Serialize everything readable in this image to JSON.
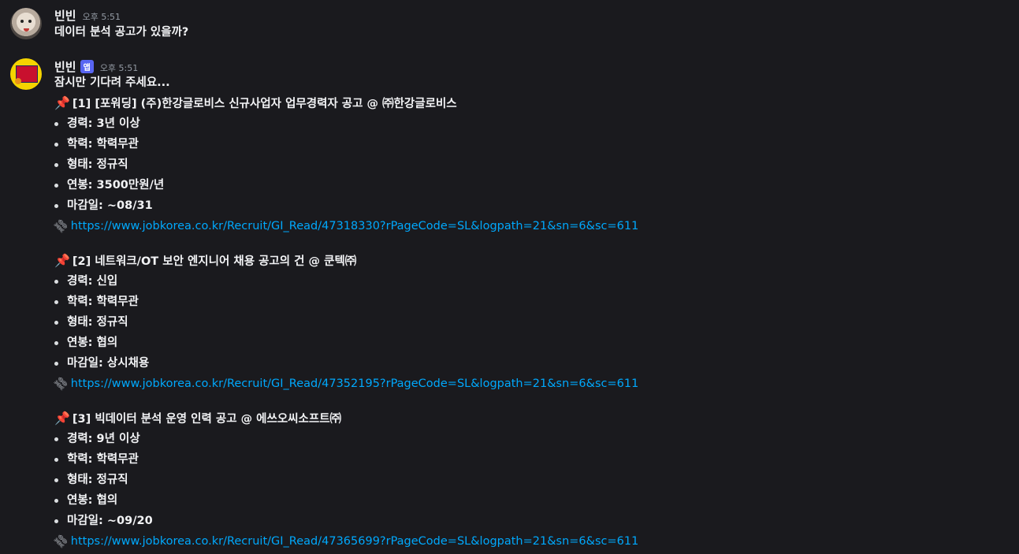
{
  "messages": [
    {
      "username": "빈빈",
      "time": "오후 5:51",
      "text": "데이터 분석 공고가 있을까?"
    },
    {
      "username": "빈빈",
      "app_tag": "앱",
      "time": "오후 5:51",
      "intro": "잠시만 기다려 주세요...",
      "jobs": [
        {
          "title": "[1] [포워딩] (주)한강글로비스 신규사업자 업무경력자 공고 @ ㈜한강글로비스",
          "details": [
            "경력: 3년 이상",
            "학력: 학력무관",
            "형태: 정규직",
            "연봉: 3500만원/년",
            "마감일: ~08/31"
          ],
          "url": "https://www.jobkorea.co.kr/Recruit/GI_Read/47318330?rPageCode=SL&logpath=21&sn=6&sc=611"
        },
        {
          "title": "[2] 네트워크/OT 보안 엔지니어 채용 공고의 건 @ 쿤텍㈜",
          "details": [
            "경력: 신입",
            "학력: 학력무관",
            "형태: 정규직",
            "연봉: 협의",
            "마감일: 상시채용"
          ],
          "url": "https://www.jobkorea.co.kr/Recruit/GI_Read/47352195?rPageCode=SL&logpath=21&sn=6&sc=611"
        },
        {
          "title": "[3] 빅데이터 분석 운영 인력 공고 @ 에쓰오씨소프트㈜",
          "details": [
            "경력: 9년 이상",
            "학력: 학력무관",
            "형태: 정규직",
            "연봉: 협의",
            "마감일: ~09/20"
          ],
          "url": "https://www.jobkorea.co.kr/Recruit/GI_Read/47365699?rPageCode=SL&logpath=21&sn=6&sc=611"
        }
      ]
    }
  ],
  "icons": {
    "pin": "pushpin-icon",
    "link": "link-icon"
  },
  "colors": {
    "background": "#1a1a1e",
    "link": "#00a8fc",
    "app_tag": "#5865f2",
    "pin": "#e0374a"
  }
}
